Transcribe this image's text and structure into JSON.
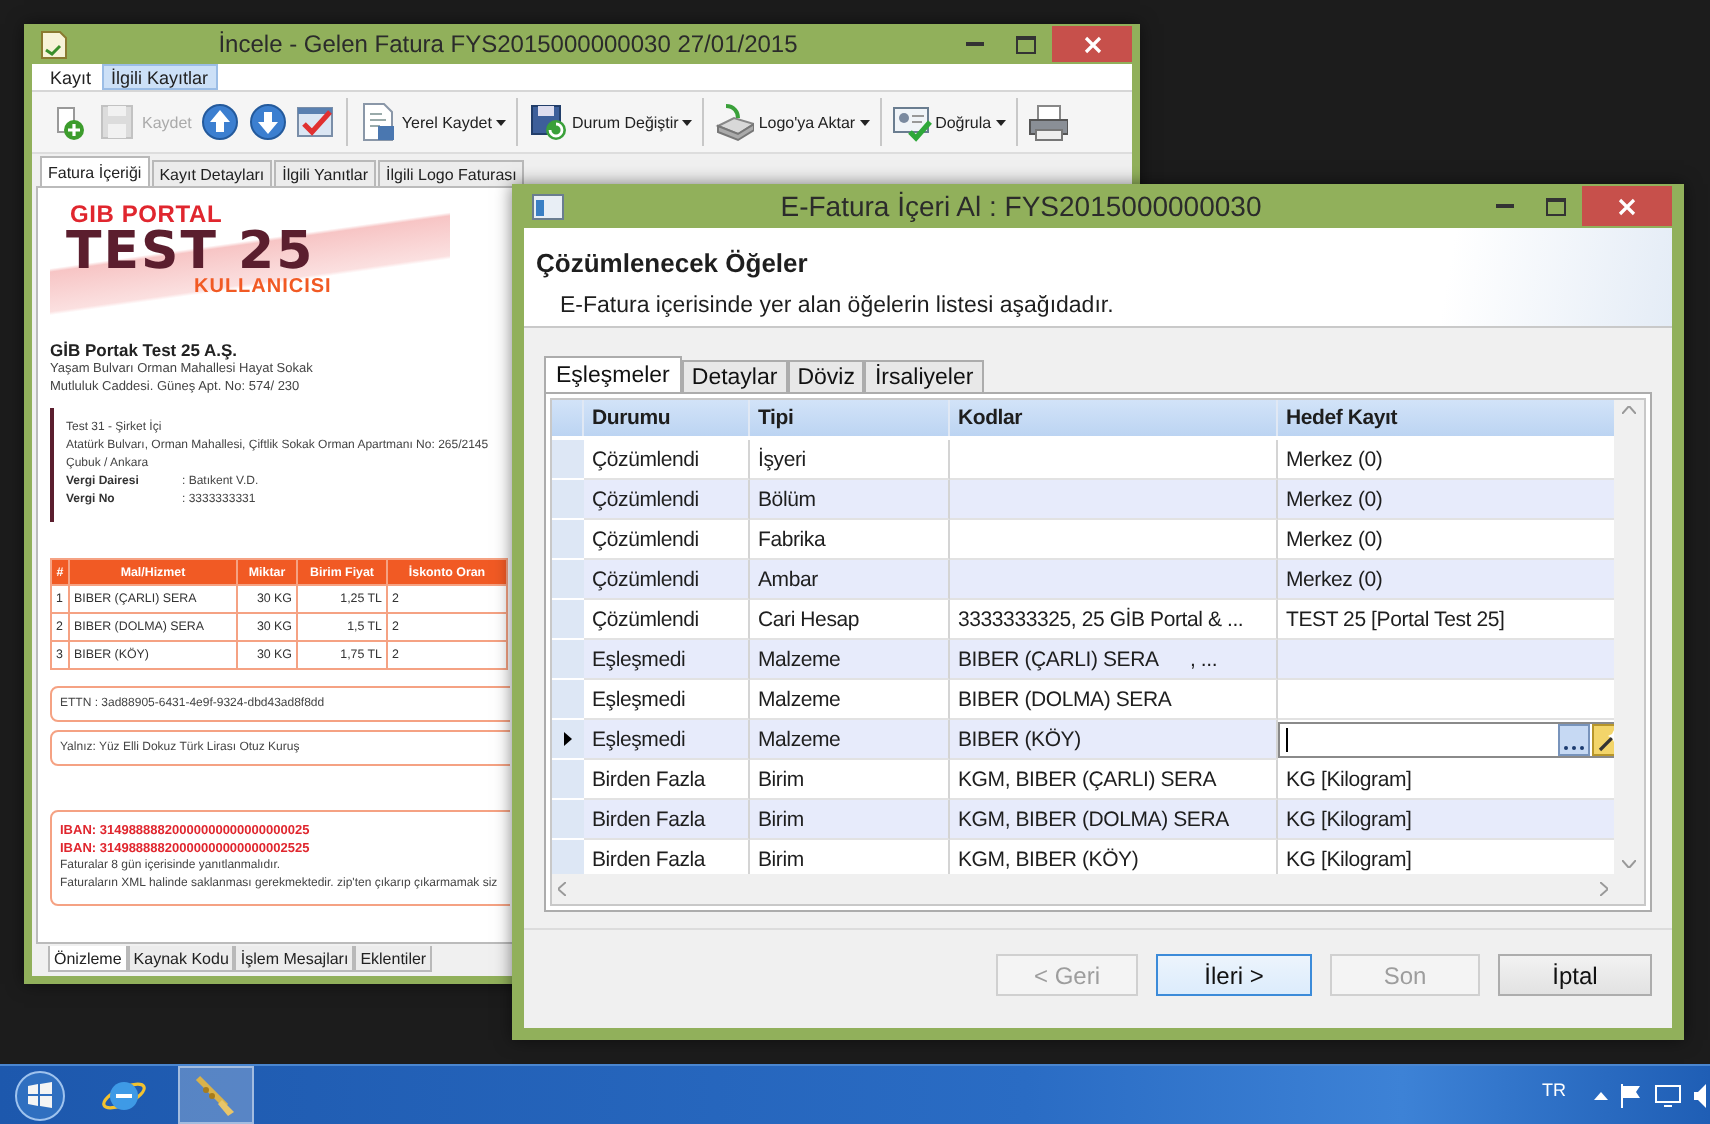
{
  "background_window": {
    "title": "İncele - Gelen Fatura FYS2015000000030 27/01/2015",
    "ribbon_tabs": [
      {
        "label": "Kayıt",
        "selected": false
      },
      {
        "label": "İlgili Kayıtlar",
        "selected": true
      }
    ],
    "toolbar": [
      {
        "kind": "button",
        "disabled": false
      },
      {
        "kind": "button",
        "label": "Kaydet",
        "disabled": true
      },
      {
        "kind": "button",
        "disabled": false
      },
      {
        "kind": "button",
        "disabled": false
      },
      {
        "kind": "button",
        "disabled": false
      },
      {
        "kind": "split",
        "label": "Yerel Kaydet",
        "disabled": false
      },
      {
        "kind": "split",
        "label": "Durum Değiştir",
        "disabled": false
      },
      {
        "kind": "split",
        "label": "Logo'ya Aktar",
        "disabled": false
      },
      {
        "kind": "split",
        "label": "Doğrula",
        "disabled": false
      },
      {
        "kind": "button",
        "disabled": false
      }
    ],
    "tabs": [
      {
        "label": "Fatura İçeriği",
        "selected": true
      },
      {
        "label": "Kayıt Detayları",
        "selected": false
      },
      {
        "label": "İlgili Yanıtlar",
        "selected": false
      },
      {
        "label": "İlgili Logo Faturası",
        "selected": false
      }
    ],
    "invoice": {
      "logo": [
        "GIB PORTAL",
        "TEST 25",
        "KULLANICISI"
      ],
      "sender": {
        "name": "GİB Portak Test 25 A.Ş.",
        "address": [
          "Yaşam Bulvarı Orman Mahallesi Hayat Sokak",
          "Mutluluk Caddesi. Güneş Apt. No: 574/ 230"
        ]
      },
      "recipient": {
        "lines": [
          "Test 31 - Şirket İçi",
          "Atatürk Bulvarı, Orman Mahallesi, Çiftlik Sokak Orman Apartmanı No: 265/2145",
          "Çubuk / Ankara"
        ],
        "fields": [
          {
            "label": "Vergi Dairesi",
            "value": ": Batıkent V.D."
          },
          {
            "label": "Vergi No",
            "value": ": 3333333331"
          }
        ]
      },
      "items": {
        "columns": [
          "#",
          "Mal/Hizmet",
          "Miktar",
          "Birim Fiyat",
          "İskonto Oran"
        ],
        "rows": [
          [
            "1",
            "BIBER (ÇARLI) SERA",
            "30 KG",
            "1,25 TL",
            "2"
          ],
          [
            "2",
            "BIBER (DOLMA) SERA",
            "30 KG",
            "1,5 TL",
            "2"
          ],
          [
            "3",
            "BIBER (KÖY)",
            "30 KG",
            "1,75 TL",
            "2"
          ]
        ]
      },
      "ettn": "ETTN : 3ad88905-6431-4e9f-9324-dbd43ad8f8dd",
      "amount_in_words": "Yalnız: Yüz Elli Dokuz Türk Lirası Otuz Kuruş",
      "iban": [
        "IBAN: 31498888820000000000000000025",
        "IBAN: 31498888820000000000000002525"
      ],
      "notes": [
        "Faturalar 8 gün içerisinde yanıtlanmalıdır.",
        "Faturaların XML halinde saklanması gerekmektedir. zip'ten çıkarıp çıkarmamak siz"
      ]
    },
    "bottom_tabs": [
      {
        "label": "Önizleme",
        "selected": true
      },
      {
        "label": "Kaynak Kodu",
        "selected": false
      },
      {
        "label": "İşlem Mesajları",
        "selected": false
      },
      {
        "label": "Eklentiler",
        "selected": false
      }
    ]
  },
  "dialog": {
    "title": "E-Fatura İçeri Al : FYS2015000000030",
    "heading": "Çözümlenecek Öğeler",
    "subtitle": "E-Fatura içerisinde yer alan öğelerin listesi aşağıdadır.",
    "tabs": [
      {
        "label": "Eşleşmeler",
        "selected": true
      },
      {
        "label": "Detaylar",
        "selected": false
      },
      {
        "label": "Döviz",
        "selected": false
      },
      {
        "label": "İrsaliyeler",
        "selected": false
      }
    ],
    "columns": [
      "Durumu",
      "Tipi",
      "Kodlar",
      "Hedef Kayıt"
    ],
    "rows": [
      {
        "durumu": "Çözümlendi",
        "tipi": "İşyeri",
        "kodlar": "",
        "hedef_kayit": "Merkez (0)",
        "selected": false
      },
      {
        "durumu": "Çözümlendi",
        "tipi": "Bölüm",
        "kodlar": "",
        "hedef_kayit": "Merkez (0)",
        "selected": false
      },
      {
        "durumu": "Çözümlendi",
        "tipi": "Fabrika",
        "kodlar": "",
        "hedef_kayit": "Merkez (0)",
        "selected": false
      },
      {
        "durumu": "Çözümlendi",
        "tipi": "Ambar",
        "kodlar": "",
        "hedef_kayit": "Merkez (0)",
        "selected": false
      },
      {
        "durumu": "Çözümlendi",
        "tipi": "Cari Hesap",
        "kodlar": "3333333325, 25 GİB Portal & ...",
        "hedef_kayit": "TEST 25 [Portal Test 25]",
        "selected": false
      },
      {
        "durumu": "Eşleşmedi",
        "tipi": "Malzeme",
        "kodlar": "BIBER (ÇARLI) SERA      , ...",
        "hedef_kayit": "",
        "selected": false
      },
      {
        "durumu": "Eşleşmedi",
        "tipi": "Malzeme",
        "kodlar": "BIBER (DOLMA) SERA",
        "hedef_kayit": "",
        "selected": false
      },
      {
        "durumu": "Eşleşmedi",
        "tipi": "Malzeme",
        "kodlar": "BIBER (KÖY)",
        "hedef_kayit": "",
        "selected": true
      },
      {
        "durumu": "Birden Fazla",
        "tipi": "Birim",
        "kodlar": "KGM, BIBER (ÇARLI) SERA",
        "hedef_kayit": "KG [Kilogram]",
        "selected": false
      },
      {
        "durumu": "Birden Fazla",
        "tipi": "Birim",
        "kodlar": "KGM, BIBER (DOLMA) SERA",
        "hedef_kayit": "KG [Kilogram]",
        "selected": false
      },
      {
        "durumu": "Birden Fazla",
        "tipi": "Birim",
        "kodlar": "KGM, BIBER (KÖY)",
        "hedef_kayit": "KG [Kilogram]",
        "selected": false
      }
    ],
    "buttons": [
      {
        "label": "< Geri",
        "disabled": true,
        "focused": false
      },
      {
        "label": "İleri >",
        "disabled": false,
        "focused": true
      },
      {
        "label": "Son",
        "disabled": true,
        "focused": false
      },
      {
        "label": "İptal",
        "disabled": false,
        "focused": false
      }
    ]
  },
  "taskbar": {
    "apps": [
      {
        "selected": false
      },
      {
        "selected": true
      }
    ],
    "language": "TR"
  }
}
